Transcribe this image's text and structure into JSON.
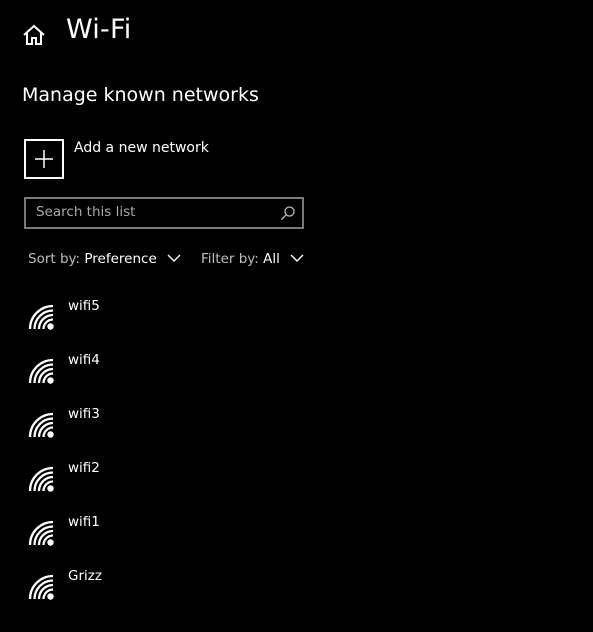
{
  "header": {
    "title": "Wi-Fi",
    "home_icon": "home-icon"
  },
  "section": {
    "title": "Manage known networks"
  },
  "add_network": {
    "label": "Add a new network",
    "icon": "plus-icon"
  },
  "search": {
    "placeholder": "Search this list",
    "icon": "search-icon"
  },
  "sort": {
    "prefix": "Sort by:",
    "value": "Preference"
  },
  "filter": {
    "prefix": "Filter by:",
    "value": "All"
  },
  "networks": [
    {
      "name": "wifi5",
      "icon": "wifi-signal-icon"
    },
    {
      "name": "wifi4",
      "icon": "wifi-signal-icon"
    },
    {
      "name": "wifi3",
      "icon": "wifi-signal-icon"
    },
    {
      "name": "wifi2",
      "icon": "wifi-signal-icon"
    },
    {
      "name": "wifi1",
      "icon": "wifi-signal-icon"
    },
    {
      "name": "Grizz",
      "icon": "wifi-signal-icon"
    }
  ],
  "colors": {
    "background": "#000000",
    "text": "#ffffff",
    "muted_text": "#bdbdbd",
    "border": "#7a7a7a"
  }
}
